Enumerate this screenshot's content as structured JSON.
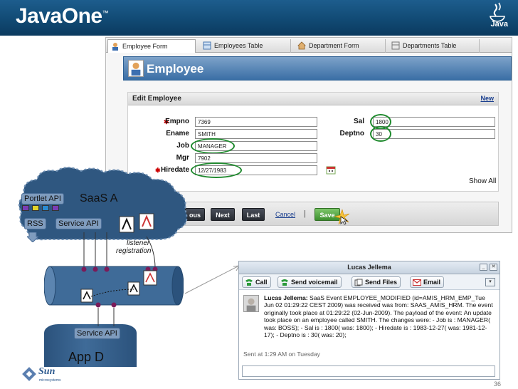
{
  "header": {
    "brand": "JavaOne",
    "brand_mark": "™",
    "java_label": "Java"
  },
  "app": {
    "tabs": [
      {
        "label": "Employee Form",
        "icon": "employee-form-icon"
      },
      {
        "label": "Employees Table",
        "icon": "table-icon"
      },
      {
        "label": "Department Form",
        "icon": "home-icon"
      },
      {
        "label": "Departments Table",
        "icon": "table-icon"
      }
    ],
    "banner_title": "Employee",
    "edit_title": "Edit Employee",
    "new_link": "New",
    "fields": {
      "empno": {
        "label": "Empno",
        "value": "7369"
      },
      "ename": {
        "label": "Ename",
        "value": "SMITH"
      },
      "job": {
        "label": "Job",
        "value": "MANAGER"
      },
      "mgr": {
        "label": "Mgr",
        "value": "7902"
      },
      "hiredate": {
        "label": "Hiredate",
        "value": "12/27/1983"
      },
      "sal": {
        "label": "Sal",
        "value": "1800"
      },
      "deptno": {
        "label": "Deptno",
        "value": "30"
      }
    },
    "show_all": "Show All",
    "buttons": {
      "previous": "ous",
      "next": "Next",
      "last": "Last",
      "cancel": "Cancel",
      "separator": "|",
      "save": "Save"
    }
  },
  "diagram": {
    "saas_a": "SaaS A",
    "portlet_api": "Portlet API",
    "rss": "RSS",
    "service_api_top": "Service API",
    "listener": "listener",
    "registration": "registration",
    "service_api_bottom": "Service API",
    "app_d": "App D"
  },
  "chat": {
    "title": "Lucas Jellema",
    "buttons": [
      "Call",
      "Send voicemail",
      "Send Files",
      "Email"
    ],
    "sender": "Lucas Jellema:",
    "message": "SaaS Event EMPLOYEE_MODIFIED (id=AMIS_HRM_EMP_Tue Jun 02 01:29:22 CEST 2009) was received was from: SAAS_AMIS_HRM. The event originally took place at 01:29:22 (02-Jun-2009). The payload of the event: An update took place on an employee called SMITH. The changes were: - Job is : MANAGER( was: BOSS); - Sal is : 1800( was: 1800); - Hiredate is : 1983-12-27( was: 1981-12-17); - Deptno is : 30( was: 20);",
    "sent": "Sent at 1:29 AM on Tuesday"
  },
  "footer": {
    "sun": "Sun",
    "sun_sub": "microsystems",
    "page": "36"
  }
}
